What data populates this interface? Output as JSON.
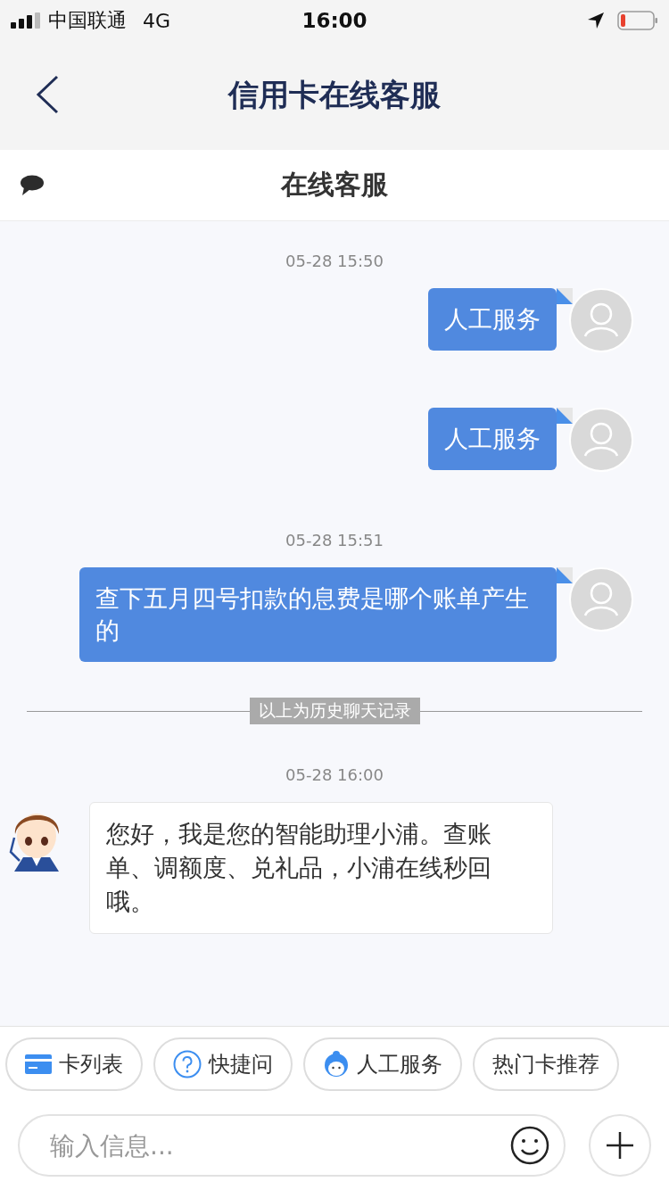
{
  "status_bar": {
    "carrier": "中国联通",
    "network": "4G",
    "time": "16:00"
  },
  "nav": {
    "title": "信用卡在线客服"
  },
  "header": {
    "title": "在线客服"
  },
  "messages": [
    {
      "kind": "time",
      "text": "05-28 15:50"
    },
    {
      "kind": "user",
      "text": "人工服务"
    },
    {
      "kind": "user",
      "text": "人工服务"
    },
    {
      "kind": "time",
      "text": "05-28 15:51"
    },
    {
      "kind": "user",
      "text": "查下五月四号扣款的息费是哪个账单产生的"
    },
    {
      "kind": "divider",
      "text": "以上为历史聊天记录"
    },
    {
      "kind": "time",
      "text": "05-28 16:00"
    },
    {
      "kind": "bot",
      "text": "您好，我是您的智能助理小浦。查账单、调额度、兑礼品，小浦在线秒回哦。"
    }
  ],
  "quick_actions": [
    {
      "kind": "card",
      "label": "卡列表"
    },
    {
      "kind": "question",
      "label": "快捷问"
    },
    {
      "kind": "agent",
      "label": "人工服务"
    },
    {
      "kind": "plain",
      "label": "热门卡推荐"
    }
  ],
  "composer": {
    "placeholder": "输入信息..."
  }
}
